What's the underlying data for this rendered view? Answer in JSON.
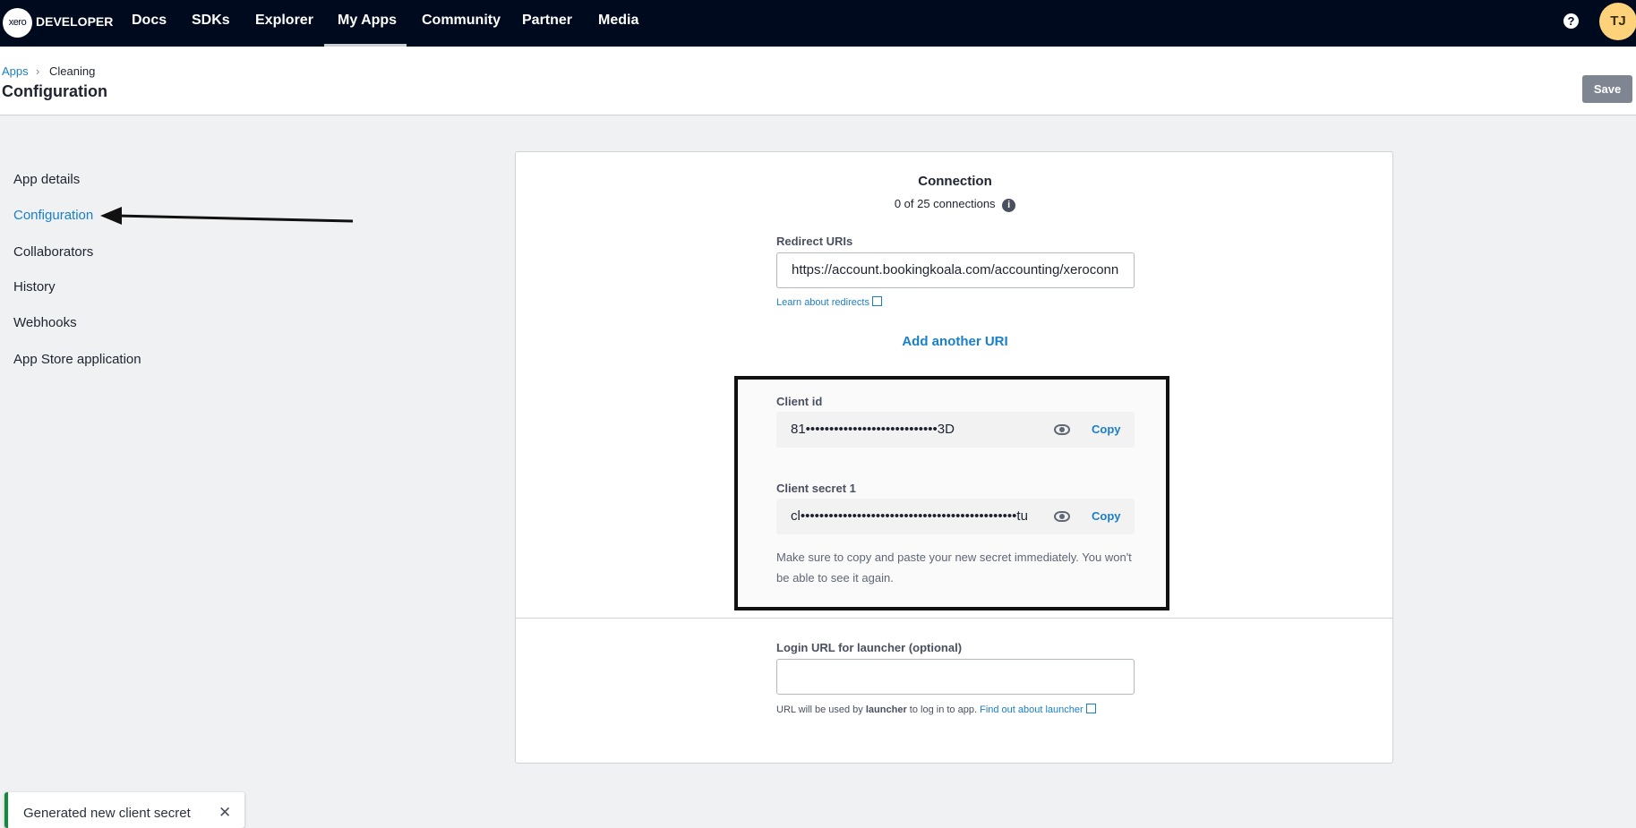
{
  "nav": {
    "logo": "xero",
    "brand": "DEVELOPER",
    "items": [
      "Docs",
      "SDKs",
      "Explorer",
      "My Apps",
      "Community",
      "Partner",
      "Media"
    ],
    "active": "My Apps",
    "help": "?",
    "avatar": "TJ"
  },
  "header": {
    "breadcrumb": [
      "Apps",
      "Cleaning"
    ],
    "sep": "›",
    "title": "Configuration",
    "save": "Save"
  },
  "sidebar": {
    "items": [
      "App details",
      "Configuration",
      "Collaborators",
      "History",
      "Webhooks",
      "App Store application"
    ],
    "active": "Configuration"
  },
  "connection": {
    "title": "Connection",
    "count": "0 of 25 connections",
    "info": "i"
  },
  "redirect": {
    "label": "Redirect URIs",
    "value": "https://account.bookingkoala.com/accounting/xeroconn",
    "learn": "Learn about redirects",
    "add": "Add another URI"
  },
  "client": {
    "id_label": "Client id",
    "id_value": "81••••••••••••••••••••••••••••3D",
    "secret_label": "Client secret 1",
    "secret_value": "cl••••••••••••••••••••••••••••••••••••••••••••••tu",
    "copy": "Copy",
    "note": "Make sure to copy and paste your new secret immediately. You won't be able to see it again."
  },
  "launcher": {
    "label": "Login URL for launcher (optional)",
    "value": "",
    "hint_pre": "URL will be used by",
    "hint_bold": "launcher",
    "hint_post": "to log in to app.",
    "link": "Find out about launcher"
  },
  "toast": {
    "text": "Generated new client secret",
    "close": "✕"
  },
  "colors": {
    "nav": "#000a1e",
    "link": "#1a7fc9",
    "toast": "#118a3b",
    "avatar": "#fdd27a"
  }
}
